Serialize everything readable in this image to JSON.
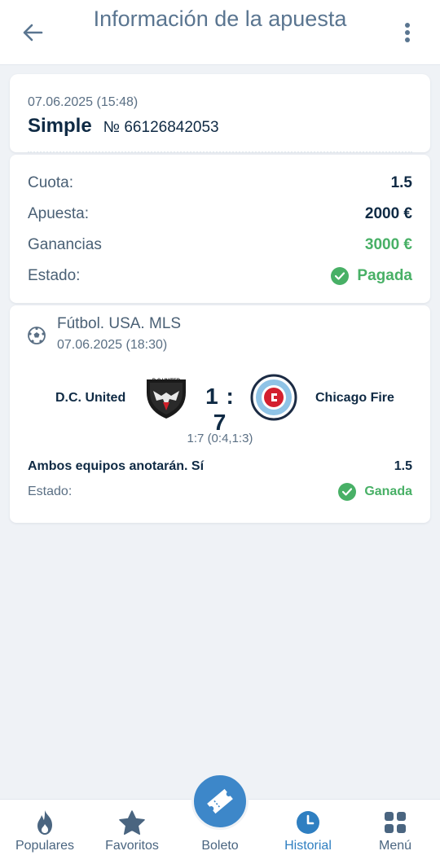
{
  "header": {
    "title": "Información de la apuesta"
  },
  "bet": {
    "datetime": "07.06.2025 (15:48)",
    "type": "Simple",
    "number": "№ 66126842053",
    "rows": [
      {
        "label": "Cuota:",
        "value": "1.5"
      },
      {
        "label": "Apuesta:",
        "value": "2000 €"
      },
      {
        "label": "Ganancias",
        "value": "3000 €"
      },
      {
        "label": "Estado:",
        "value": "Pagada"
      }
    ]
  },
  "event": {
    "league": "Fútbol. USA. MLS",
    "datetime": "07.06.2025 (18:30)",
    "home_team": "D.C. United",
    "away_team": "Chicago Fire",
    "home_logo_text": "D.C.UNITED",
    "score": "1 : 7",
    "score_detail": "1:7 (0:4,1:3)",
    "market": "Ambos equipos anotarán. Sí",
    "odds": "1.5",
    "status_label": "Estado:",
    "status_value": "Ganada"
  },
  "nav": {
    "items": [
      {
        "label": "Populares",
        "icon": "flame-icon"
      },
      {
        "label": "Favoritos",
        "icon": "star-icon"
      },
      {
        "label": "Boleto",
        "icon": "ticket-icon"
      },
      {
        "label": "Historial",
        "icon": "clock-icon",
        "active": true
      },
      {
        "label": "Menú",
        "icon": "grid-icon"
      }
    ]
  },
  "colors": {
    "accent": "#3d87c9",
    "success": "#48b066",
    "text": "#0f2a44",
    "muted": "#5a6f84"
  }
}
